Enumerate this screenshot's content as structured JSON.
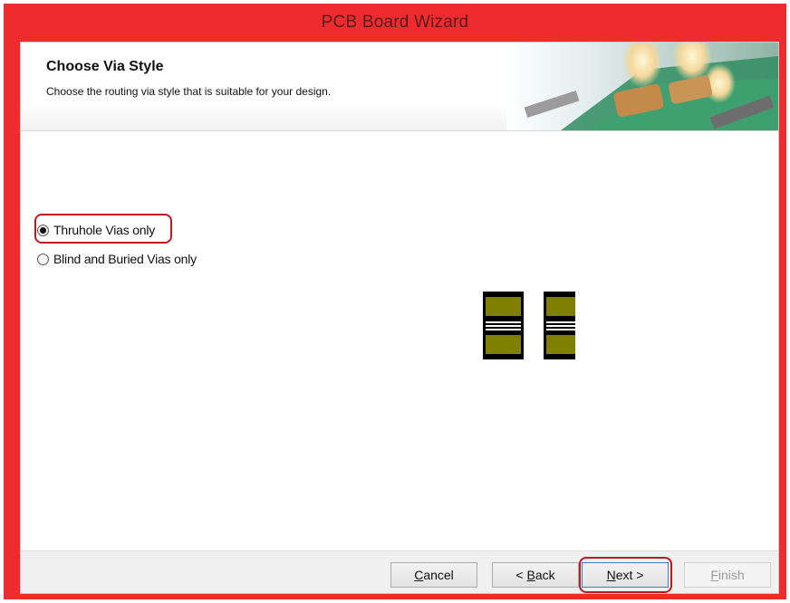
{
  "window": {
    "title": "PCB Board Wizard"
  },
  "header": {
    "title": "Choose Via Style",
    "subtitle": "Choose  the routing via style that is suitable for your design."
  },
  "options": [
    {
      "label": "Thruhole Vias only",
      "selected": true
    },
    {
      "label": "Blind and Buried Vias only",
      "selected": false
    }
  ],
  "footer": {
    "cancel": {
      "accel": "C",
      "rest": "ancel"
    },
    "back": {
      "prefix": "< ",
      "accel": "B",
      "rest": "ack"
    },
    "next": {
      "accel": "N",
      "rest": "ext >"
    },
    "finish": {
      "accel": "F",
      "rest": "inish",
      "enabled": false
    }
  },
  "colors": {
    "window_frame": "#ee2b2f",
    "annotation_outline": "#c01822",
    "via_pad": "#808000"
  }
}
